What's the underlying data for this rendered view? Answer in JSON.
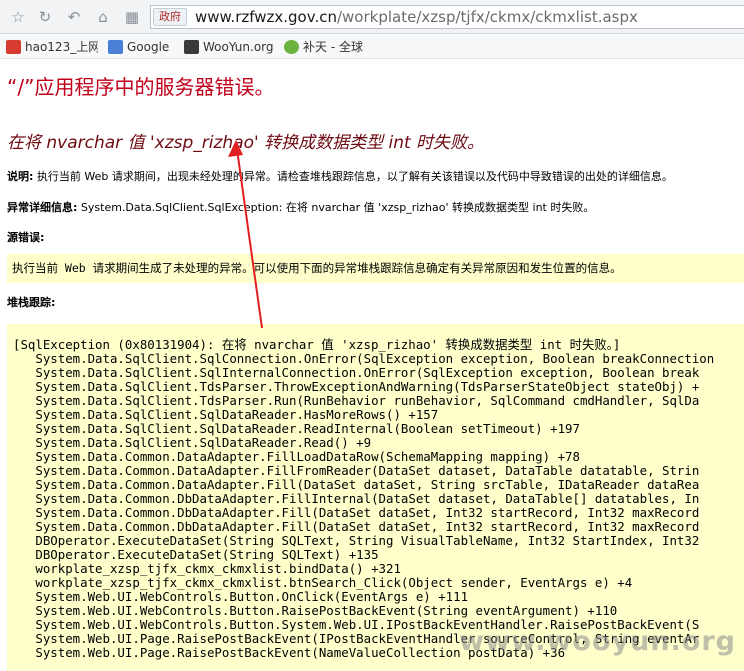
{
  "browser": {
    "site_badge": "政府",
    "url_host": "www.rzfwzx.gov.cn",
    "url_path": "/workplate/xzsp/tjfx/ckmx/ckmxlist.aspx",
    "bookmarks": [
      {
        "label": "hao123_上网",
        "icon": "hao123-icon",
        "color": "#d63b2f"
      },
      {
        "label": "Google",
        "icon": "google-icon",
        "color": "#4a7fd6"
      },
      {
        "label": "WooYun.org",
        "icon": "wooyun-icon",
        "color": "#3a3a3a"
      },
      {
        "label": "补天 - 全球",
        "icon": "butian-icon",
        "color": "#6db33f"
      }
    ]
  },
  "page": {
    "title": "“/”应用程序中的服务器错误。",
    "subtitle": "在将 nvarchar 值 'xzsp_rizhao' 转换成数据类型 int 时失败。",
    "description_label": "说明:",
    "description_text": " 执行当前 Web 请求期间，出现未经处理的异常。请检查堆栈跟踪信息，以了解有关该错误以及代码中导致错误的出处的详细信息。",
    "exception_label": "异常详细信息:",
    "exception_text": " System.Data.SqlClient.SqlException: 在将 nvarchar 值 'xzsp_rizhao' 转换成数据类型 int 时失败。",
    "source_label": "源错误:",
    "source_text": "执行当前 Web 请求期间生成了未处理的异常。可以使用下面的异常堆栈跟踪信息确定有关异常原因和发生位置的信息。",
    "stack_label": "堆栈跟踪:",
    "stack_lines": [
      "[SqlException (0x80131904): 在将 nvarchar 值 'xzsp_rizhao' 转换成数据类型 int 时失败。]",
      "   System.Data.SqlClient.SqlConnection.OnError(SqlException exception, Boolean breakConnection",
      "   System.Data.SqlClient.SqlInternalConnection.OnError(SqlException exception, Boolean break",
      "   System.Data.SqlClient.TdsParser.ThrowExceptionAndWarning(TdsParserStateObject stateObj) +",
      "   System.Data.SqlClient.TdsParser.Run(RunBehavior runBehavior, SqlCommand cmdHandler, SqlDa",
      "   System.Data.SqlClient.SqlDataReader.HasMoreRows() +157",
      "   System.Data.SqlClient.SqlDataReader.ReadInternal(Boolean setTimeout) +197",
      "   System.Data.SqlClient.SqlDataReader.Read() +9",
      "   System.Data.Common.DataAdapter.FillLoadDataRow(SchemaMapping mapping) +78",
      "   System.Data.Common.DataAdapter.FillFromReader(DataSet dataset, DataTable datatable, Strin",
      "   System.Data.Common.DataAdapter.Fill(DataSet dataSet, String srcTable, IDataReader dataRea",
      "   System.Data.Common.DbDataAdapter.FillInternal(DataSet dataset, DataTable[] datatables, In",
      "   System.Data.Common.DbDataAdapter.Fill(DataSet dataSet, Int32 startRecord, Int32 maxRecord",
      "   System.Data.Common.DbDataAdapter.Fill(DataSet dataSet, Int32 startRecord, Int32 maxRecord",
      "   DBOperator.ExecuteDataSet(String SQLText, String VisualTableName, Int32 StartIndex, Int32",
      "   DBOperator.ExecuteDataSet(String SQLText) +135",
      "   workplate_xzsp_tjfx_ckmx_ckmxlist.bindData() +321",
      "   workplate_xzsp_tjfx_ckmx_ckmxlist.btnSearch_Click(Object sender, EventArgs e) +4",
      "   System.Web.UI.WebControls.Button.OnClick(EventArgs e) +111",
      "   System.Web.UI.WebControls.Button.RaisePostBackEvent(String eventArgument) +110",
      "   System.Web.UI.WebControls.Button.System.Web.UI.IPostBackEventHandler.RaisePostBackEvent(S",
      "   System.Web.UI.Page.RaisePostBackEvent(IPostBackEventHandler sourceControl, String eventAr",
      "   System.Web.UI.Page.RaisePostBackEvent(NameValueCollection postData) +36"
    ]
  },
  "watermark": "www.wooyun.org",
  "colors": {
    "title_red": "#c0001a",
    "subtitle_maroon": "#6e0a12",
    "code_background": "#ffffcc",
    "arrow_red": "#e02020"
  }
}
